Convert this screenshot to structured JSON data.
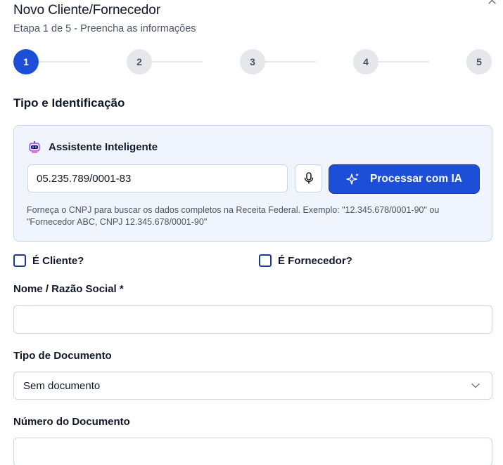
{
  "dialog": {
    "title": "Novo Cliente/Fornecedor",
    "subtitle": "Etapa 1 de 5 - Preencha as informações",
    "close_icon": "close-icon"
  },
  "stepper": {
    "current_step": 1,
    "steps": [
      "1",
      "2",
      "3",
      "4",
      "5"
    ],
    "active_color": "#1d4ed8",
    "inactive_color": "#e5e7eb"
  },
  "section": {
    "title": "Tipo e Identificação"
  },
  "assistant": {
    "icon": "robot-icon",
    "title": "Assistente Inteligente",
    "input_value": "05.235.789/0001-83",
    "mic_icon": "microphone-icon",
    "process_icon": "sparkles-icon",
    "process_label": "Processar com IA",
    "help_text": "Forneça o CNPJ para buscar os dados completos na Receita Federal. Exemplo: \"12.345.678/0001-90\" ou \"Fornecedor ABC, CNPJ 12.345.678/0001-90\""
  },
  "checkboxes": {
    "cliente_label": "É Cliente?",
    "cliente_checked": false,
    "fornecedor_label": "É Fornecedor?",
    "fornecedor_checked": false
  },
  "fields": {
    "nome_label": "Nome / Razão Social *",
    "nome_value": "",
    "tipo_documento_label": "Tipo de Documento",
    "tipo_documento_value": "Sem documento",
    "numero_documento_label": "Número do Documento",
    "numero_documento_value": ""
  }
}
